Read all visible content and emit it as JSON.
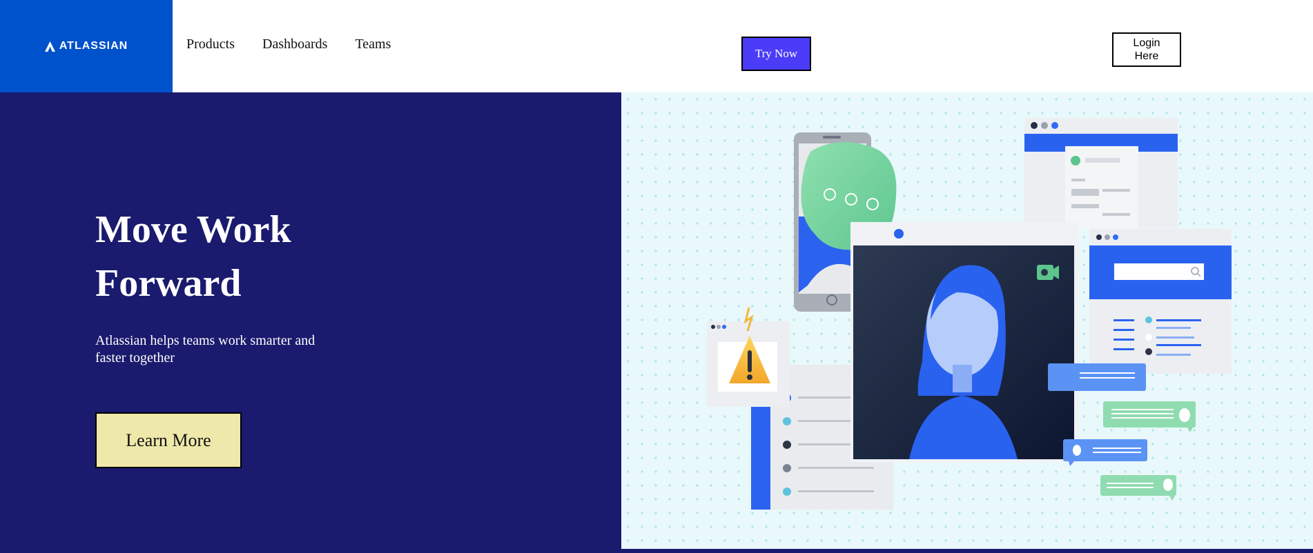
{
  "brand": {
    "name": "ATLASSIAN",
    "color": "#0052cc"
  },
  "nav": {
    "links": [
      "Products",
      "Dashboards",
      "Teams"
    ],
    "try_label": "Try Now",
    "login_label": "Login Here"
  },
  "hero": {
    "title": "Move Work Forward",
    "subtitle": "Atlassian helps teams work smarter and faster together",
    "cta_label": "Learn More",
    "bg_color": "#1a1a6e",
    "cta_color": "#eee8aa"
  },
  "illustration": {
    "icons": [
      "phone-icon",
      "chat-bubble-icon",
      "video-call-icon",
      "person-avatar-icon",
      "warning-icon",
      "search-icon",
      "browser-window-icon",
      "message-bubble-icon"
    ]
  }
}
